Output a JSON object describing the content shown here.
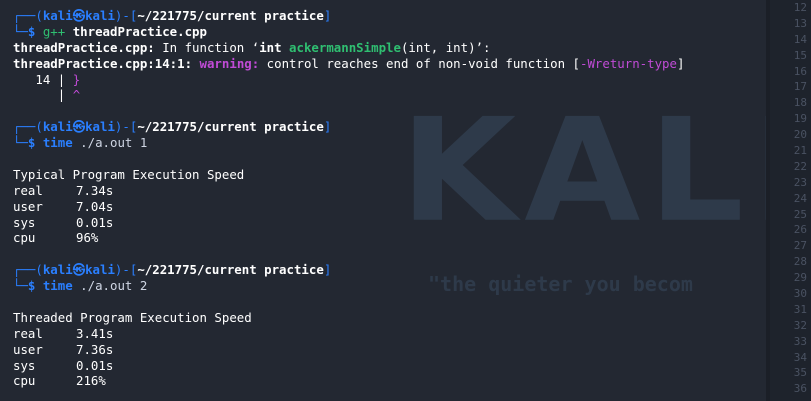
{
  "watermark": {
    "logo": "KALI",
    "tagline": "\"the quieter you becom"
  },
  "prompt": {
    "user": "kali",
    "host": "kali",
    "cwd": "~/221775/current practice",
    "at": "㉿"
  },
  "block1": {
    "cmd": "g++",
    "arg": "threadPractice.cpp",
    "err1_a": "threadPractice.cpp:",
    "err1_b": " In function ‘",
    "err1_c": "int",
    "err1_d": "ackermannSimple",
    "err1_e": "(int, int)’:",
    "err2_a": "threadPractice.cpp:14:1:",
    "err2_b": "warning:",
    "err2_c": " control reaches end of non-void function [",
    "err2_d": "-Wreturn-type",
    "err2_e": "]",
    "code_line_no": "   14 | ",
    "code_brace": "}",
    "caret_pre": "      | ",
    "caret": "^"
  },
  "block2": {
    "cmd": "time",
    "arg": " ./a.out 1",
    "heading": "Typical Program Execution Speed",
    "rows": [
      {
        "k": "real",
        "v": "7.34s"
      },
      {
        "k": "user",
        "v": "7.04s"
      },
      {
        "k": "sys",
        "v": "0.01s"
      },
      {
        "k": "cpu",
        "v": "96%"
      }
    ]
  },
  "block3": {
    "cmd": "time",
    "arg": " ./a.out 2",
    "heading": "Threaded Program Execution Speed",
    "rows": [
      {
        "k": "real",
        "v": "3.41s"
      },
      {
        "k": "user",
        "v": "7.36s"
      },
      {
        "k": "sys",
        "v": "0.01s"
      },
      {
        "k": "cpu",
        "v": "216%"
      }
    ]
  },
  "gutter": [
    "12",
    "13",
    "14",
    "15",
    "16",
    "17",
    "18",
    "19",
    "20",
    "21",
    "22",
    "23",
    "24",
    "25",
    "26",
    "27",
    "28",
    "29",
    "30",
    "31",
    "32",
    "33",
    "34",
    "35",
    "36"
  ]
}
